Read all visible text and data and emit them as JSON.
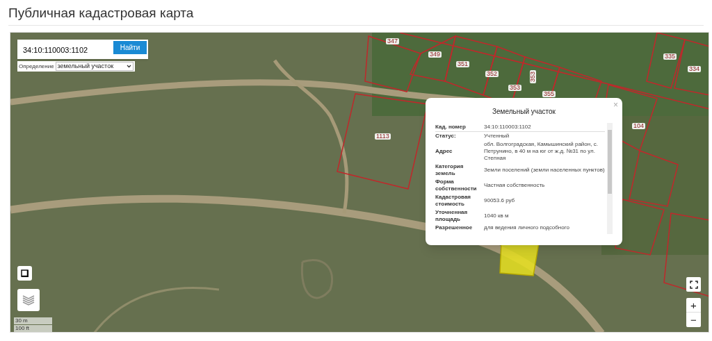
{
  "page_title": "Публичная кадастровая карта",
  "search": {
    "value": "34:10:110003:1102",
    "button": "Найти"
  },
  "definition": {
    "label": "Определение",
    "value": "земельный участок"
  },
  "map": {
    "parcel_labels": [
      "347",
      "349",
      "351",
      "352",
      "353",
      "353",
      "355",
      "335",
      "334",
      "104",
      "1113"
    ]
  },
  "popup": {
    "title": "Земельный участок",
    "close": "×",
    "rows": [
      {
        "label": "Кад. номер",
        "value": "34:10:110003:1102"
      },
      {
        "label": "Статус:",
        "value": "Учтенный"
      },
      {
        "label": "Адрес",
        "value": "обл. Волгоградская, Камышинский район, с. Петрунино, в 40 м на юг от ж.д. №31 по ул. Степная"
      },
      {
        "label": "Категория земель",
        "value": "Земли поселений (земли населенных пунктов)"
      },
      {
        "label": "Форма собственности",
        "value": "Частная собственность"
      },
      {
        "label": "Кадастровая стоимость",
        "value": "90053.6 руб"
      },
      {
        "label": "Уточненная площадь",
        "value": "1040 кв м"
      },
      {
        "label": "Разрешенное",
        "value": "для ведения личного подсобного"
      }
    ]
  },
  "scale": [
    "30 m",
    "100 ft"
  ],
  "zoom": {
    "in": "+",
    "out": "−"
  }
}
